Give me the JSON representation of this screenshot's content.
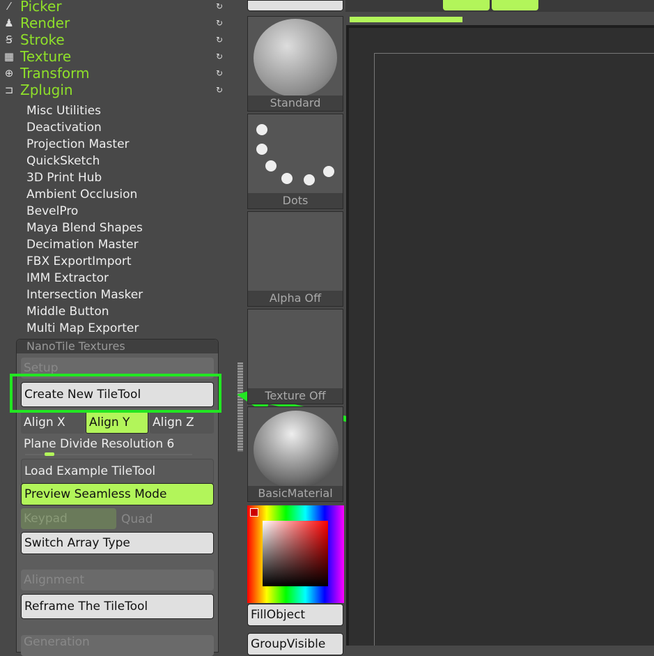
{
  "menu": [
    {
      "label": "Picker",
      "icon": "picker-icon",
      "glyph": "⁄"
    },
    {
      "label": "Render",
      "icon": "render-icon",
      "glyph": "♟"
    },
    {
      "label": "Stroke",
      "icon": "stroke-icon",
      "glyph": "Ꞩ"
    },
    {
      "label": "Texture",
      "icon": "texture-icon",
      "glyph": "▦"
    },
    {
      "label": "Transform",
      "icon": "transform-icon",
      "glyph": "⊕"
    },
    {
      "label": "Zplugin",
      "icon": "zplugin-icon",
      "glyph": "⊐"
    }
  ],
  "refresh_glyph": "↻",
  "plugins": [
    "Misc Utilities",
    "Deactivation",
    "Projection Master",
    "QuickSketch",
    "3D Print Hub",
    "Ambient Occlusion",
    "BevelPro",
    "Maya Blend Shapes",
    "Decimation Master",
    "FBX ExportImport",
    "IMM Extractor",
    "Intersection Masker",
    "Middle Button",
    "Multi Map Exporter"
  ],
  "nanotile": {
    "title": "NanoTile Textures",
    "setup": "Setup",
    "create": "Create New TileTool",
    "align_x": "Align X",
    "align_y": "Align Y",
    "align_z": "Align Z",
    "plane_divide": "Plane Divide Resolution 6",
    "plane_divide_value": 6,
    "load_example": "Load Example TileTool",
    "preview": "Preview Seamless Mode",
    "keypad": "Keypad",
    "quad": "Quad",
    "switch_array": "Switch Array Type",
    "alignment": "Alignment",
    "reframe": "Reframe The TileTool",
    "generation": "Generation"
  },
  "shelf": {
    "brush": "Standard",
    "stroke": "Dots",
    "alpha": "Alpha Off",
    "texture": "Texture Off",
    "material": "BasicMaterial",
    "fill": "FillObject",
    "group": "GroupVisible"
  },
  "progress_percent": 37,
  "colors": {
    "accent": "#b2f55a",
    "highlight": "#22e622",
    "menu_text": "#8fe02a"
  }
}
